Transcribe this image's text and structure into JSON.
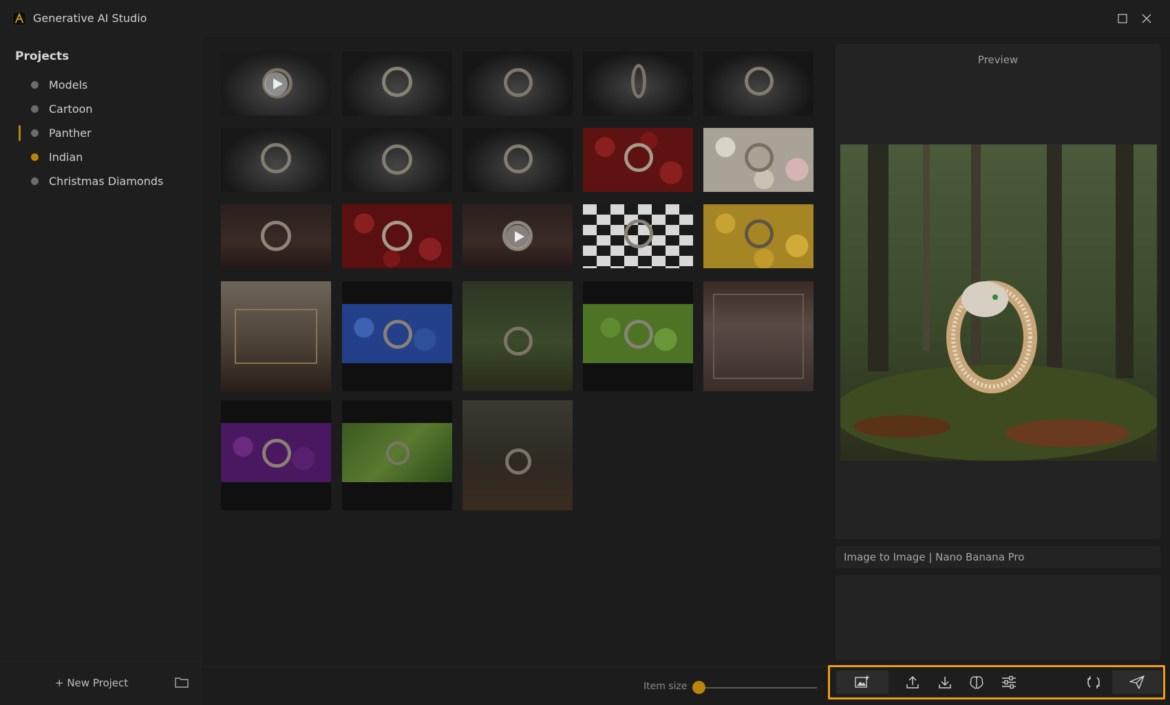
{
  "window": {
    "title": "Generative AI Studio"
  },
  "sidebar": {
    "heading": "Projects",
    "items": [
      {
        "label": "Models",
        "dot": "grey",
        "active": false
      },
      {
        "label": "Cartoon",
        "dot": "grey",
        "active": false
      },
      {
        "label": "Panther",
        "dot": "grey",
        "active": true
      },
      {
        "label": "Indian",
        "dot": "gold",
        "active": false
      },
      {
        "label": "Christmas Diamonds",
        "dot": "grey",
        "active": false
      }
    ],
    "new_project_label": "+ New Project"
  },
  "grid": {
    "item_size_label": "Item size",
    "item_size_value": 0.0
  },
  "preview": {
    "title": "Preview",
    "model_label": "Image to Image | Nano Banana Pro",
    "prompt_text": ""
  },
  "toolbar": {
    "buttons": [
      "add-image-icon",
      "upload-icon",
      "download-icon",
      "brain-icon",
      "sliders-icon",
      "refresh-icon",
      "send-icon"
    ]
  },
  "colors": {
    "accent": "#b8860b",
    "highlight": "#f39c12",
    "background": "#1c1c1c",
    "panel": "#232323"
  }
}
